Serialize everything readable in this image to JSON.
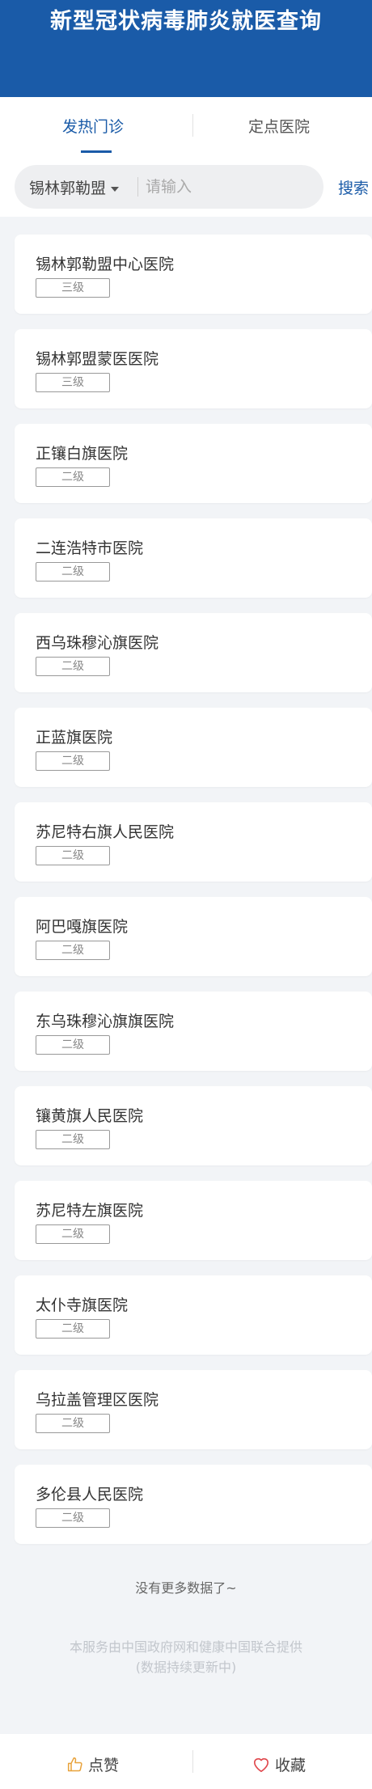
{
  "header": {
    "title": "新型冠状病毒肺炎就医查询"
  },
  "tabs": [
    {
      "label": "发热门诊",
      "active": true
    },
    {
      "label": "定点医院",
      "active": false
    }
  ],
  "search": {
    "region": "锡林郭勒盟",
    "placeholder": "请输入",
    "value": "",
    "button_label": "搜索"
  },
  "hospitals": [
    {
      "name": "锡林郭勒盟中心医院",
      "level": "三级"
    },
    {
      "name": "锡林郭盟蒙医医院",
      "level": "三级"
    },
    {
      "name": "正镶白旗医院",
      "level": "二级"
    },
    {
      "name": "二连浩特市医院",
      "level": "二级"
    },
    {
      "name": "西乌珠穆沁旗医院",
      "level": "二级"
    },
    {
      "name": "正蓝旗医院",
      "level": "二级"
    },
    {
      "name": "苏尼特右旗人民医院",
      "level": "二级"
    },
    {
      "name": "阿巴嘎旗医院",
      "level": "二级"
    },
    {
      "name": "东乌珠穆沁旗旗医院",
      "level": "二级"
    },
    {
      "name": "镶黄旗人民医院",
      "level": "二级"
    },
    {
      "name": "苏尼特左旗医院",
      "level": "二级"
    },
    {
      "name": "太仆寺旗医院",
      "level": "二级"
    },
    {
      "name": "乌拉盖管理区医院",
      "level": "二级"
    },
    {
      "name": "多伦县人民医院",
      "level": "二级"
    }
  ],
  "footer": {
    "no_more": "没有更多数据了~",
    "provider_line1": "本服务由中国政府网和健康中国联合提供",
    "provider_line2": "(数据持续更新中)"
  },
  "bottom_bar": {
    "like_label": "点赞",
    "like_icon": "thumbs-up-icon",
    "favorite_label": "收藏",
    "favorite_icon": "heart-icon"
  },
  "colors": {
    "brand": "#1a5ba8",
    "favorite": "#e0474c",
    "like": "#e8a23a"
  }
}
